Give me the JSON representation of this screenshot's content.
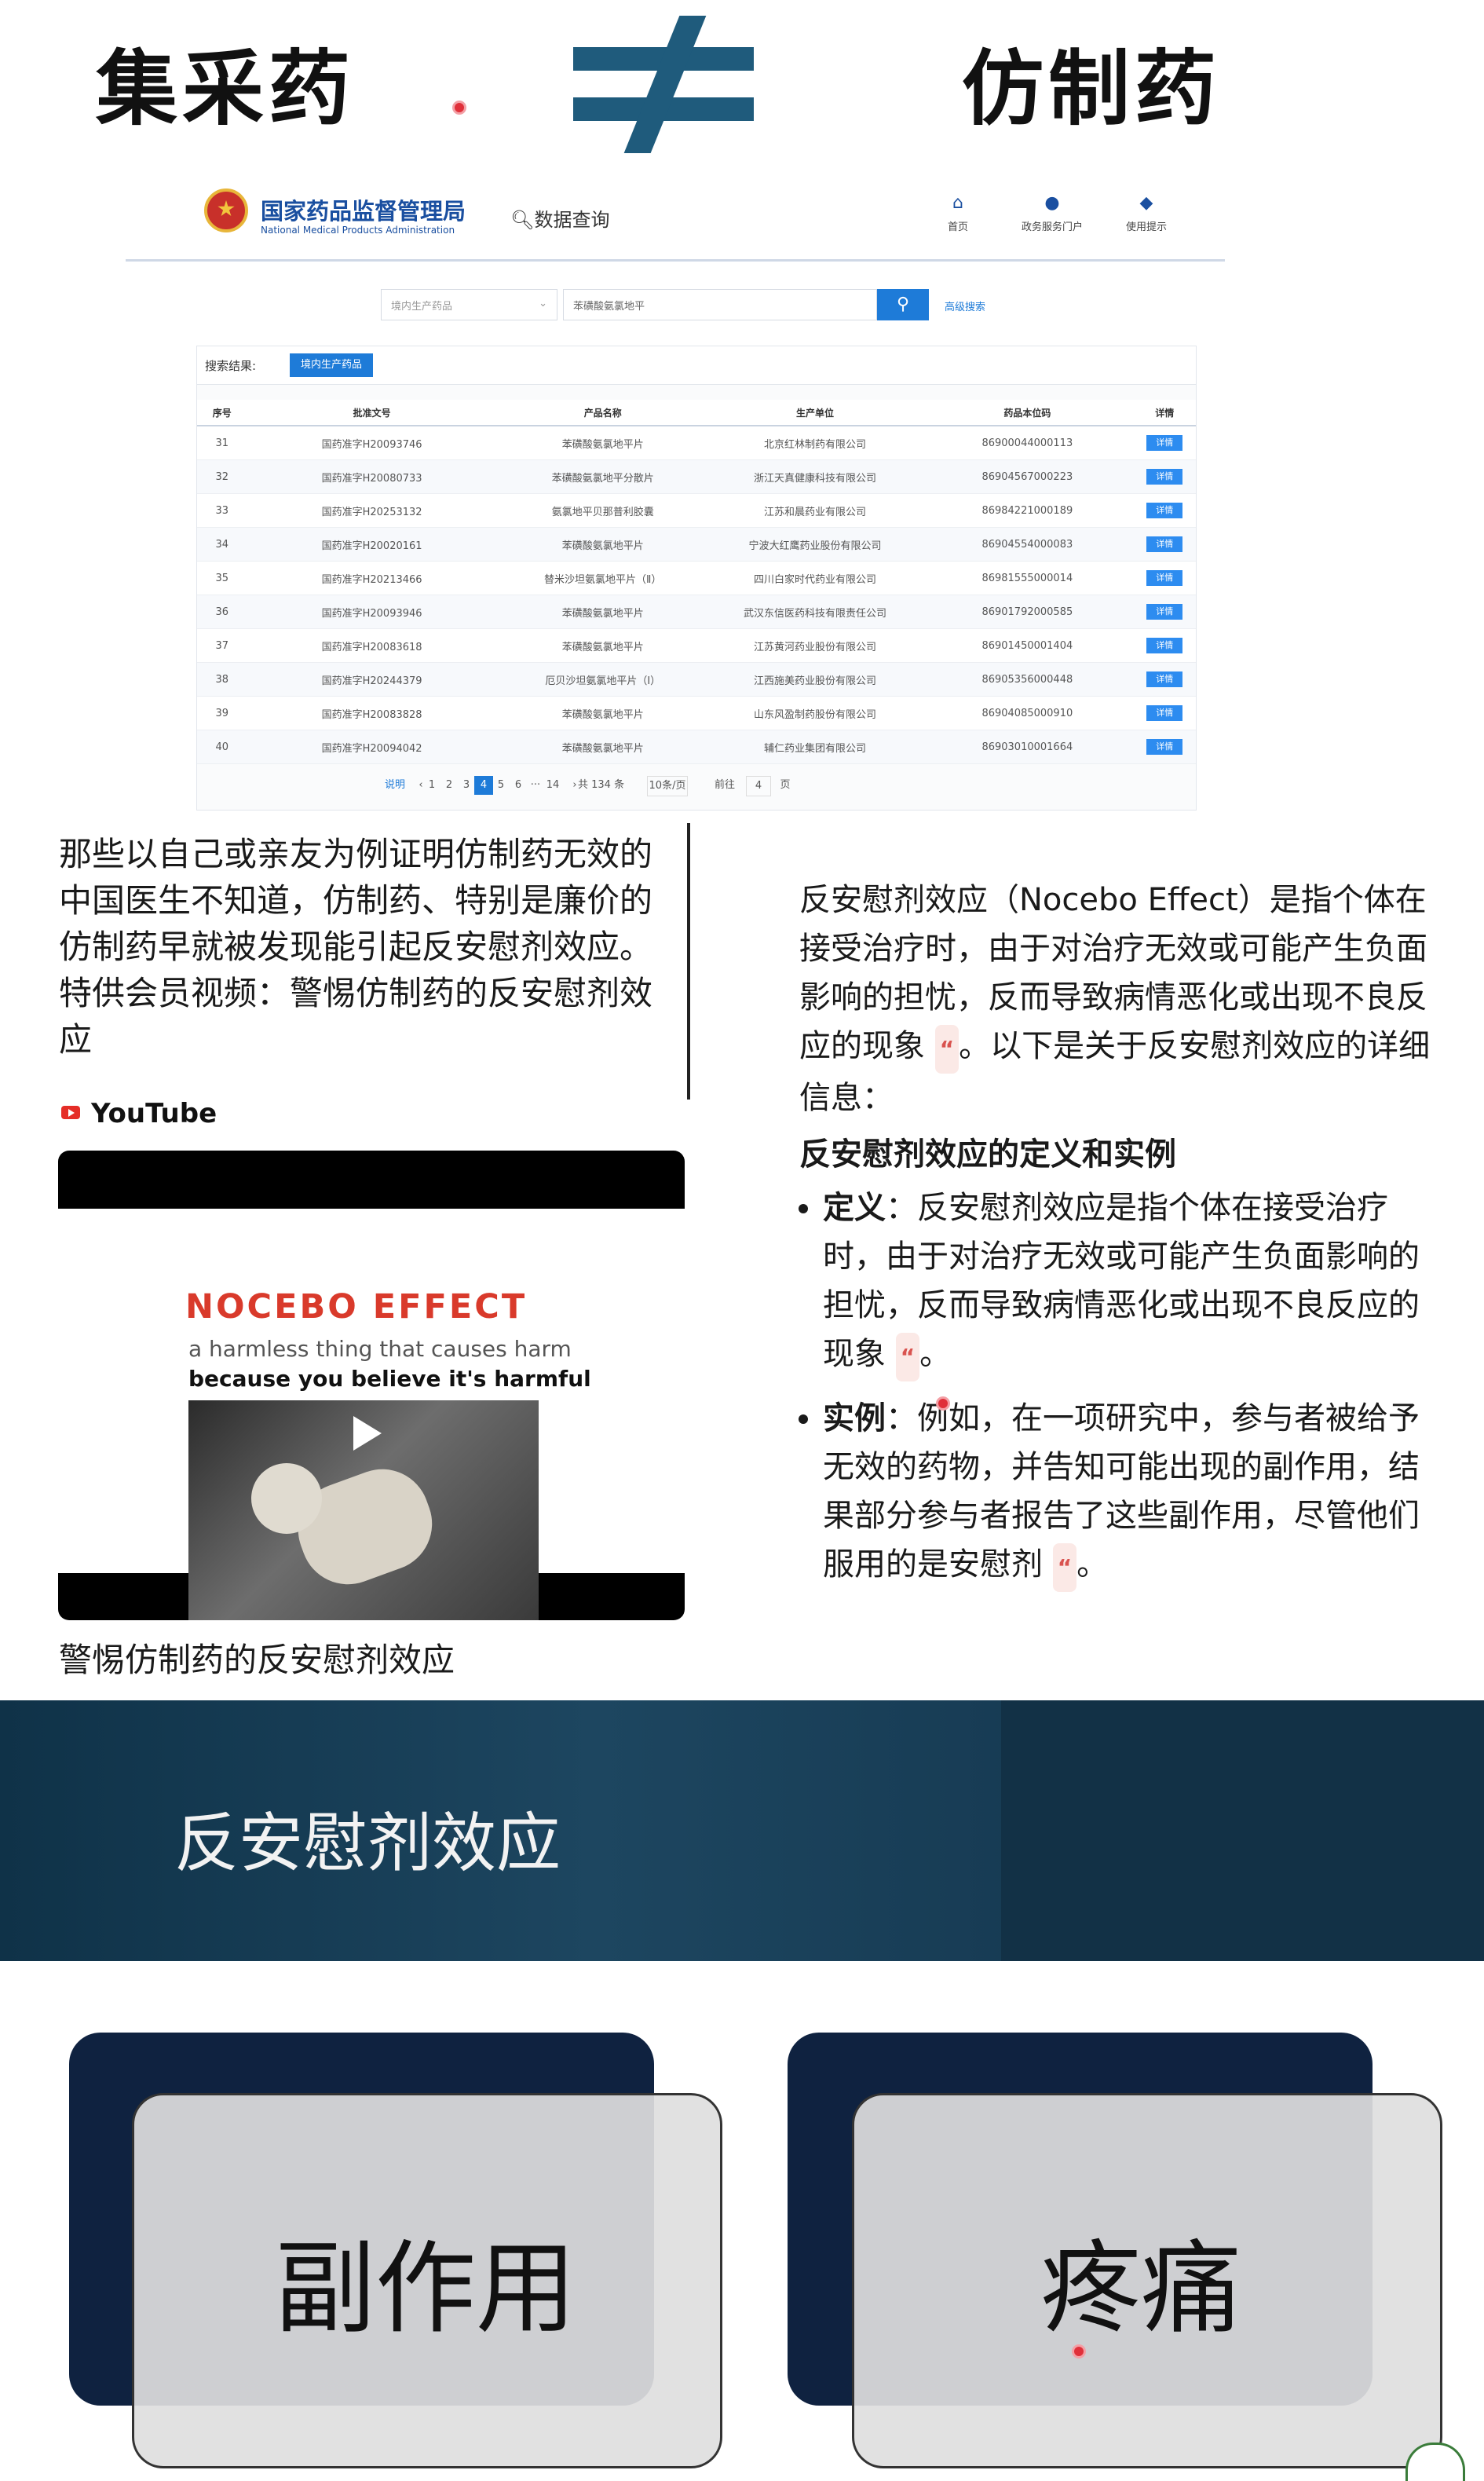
{
  "top": {
    "left_title": "集采药",
    "right_title": "仿制药"
  },
  "nmpa": {
    "agency_cn": "国家药品监督管理局",
    "agency_en": "National Medical Products Administration",
    "data_query": "数据查询",
    "nav": [
      {
        "label": "首页",
        "icon": "home-icon"
      },
      {
        "label": "政务服务门户",
        "icon": "user-icon"
      },
      {
        "label": "使用提示",
        "icon": "location-icon"
      }
    ],
    "select_value": "境内生产药品",
    "search_value": "苯磺酸氨氯地平",
    "advanced_search": "高级搜索",
    "result_label": "搜索结果:",
    "result_tag": "境内生产药品",
    "columns": [
      "序号",
      "批准文号",
      "产品名称",
      "生产单位",
      "药品本位码",
      "详情"
    ],
    "rows": [
      [
        "31",
        "国药准字H20093746",
        "苯磺酸氨氯地平片",
        "北京红林制药有限公司",
        "86900044000113",
        "详情"
      ],
      [
        "32",
        "国药准字H20080733",
        "苯磺酸氨氯地平分散片",
        "浙江天真健康科技有限公司",
        "86904567000223",
        "详情"
      ],
      [
        "33",
        "国药准字H20253132",
        "氨氯地平贝那普利胶囊",
        "江苏和晨药业有限公司",
        "86984221000189",
        "详情"
      ],
      [
        "34",
        "国药准字H20020161",
        "苯磺酸氨氯地平片",
        "宁波大红鹰药业股份有限公司",
        "86904554000083",
        "详情"
      ],
      [
        "35",
        "国药准字H20213466",
        "替米沙坦氨氯地平片（Ⅱ）",
        "四川白家时代药业有限公司",
        "86981555000014",
        "详情"
      ],
      [
        "36",
        "国药准字H20093946",
        "苯磺酸氨氯地平片",
        "武汉东信医药科技有限责任公司",
        "86901792000585",
        "详情"
      ],
      [
        "37",
        "国药准字H20083618",
        "苯磺酸氨氯地平片",
        "江苏黄河药业股份有限公司",
        "86901450001404",
        "详情"
      ],
      [
        "38",
        "国药准字H20244379",
        "厄贝沙坦氨氯地平片（Ⅰ）",
        "江西施美药业股份有限公司",
        "86905356000448",
        "详情"
      ],
      [
        "39",
        "国药准字H20083828",
        "苯磺酸氨氯地平片",
        "山东风盈制药股份有限公司",
        "86904085000910",
        "详情"
      ],
      [
        "40",
        "国药准字H20094042",
        "苯磺酸氨氯地平片",
        "辅仁药业集团有限公司",
        "86903010001664",
        "详情"
      ]
    ],
    "pager": {
      "note": "说明",
      "prev": "‹",
      "pages": [
        "1",
        "2",
        "3",
        "4",
        "5",
        "6",
        "···",
        "14"
      ],
      "current": "4",
      "next": "›",
      "total": "共 134 条",
      "per_page": "10条/页",
      "goto": "前往",
      "goto_value": "4",
      "page_unit": "页"
    }
  },
  "left_post": {
    "text": "那些以自己或亲友为例证明仿制药无效的中国医生不知道，仿制药、特别是廉价的仿制药早就被发现能引起反安慰剂效应。特供会员视频：警惕仿制药的反安慰剂效应",
    "source": "YouTube",
    "video_title_big": "NOCEBO EFFECT",
    "video_line1": "a harmless thing  that causes harm",
    "video_line2": "because you believe it's harmful",
    "caption": "警惕仿制药的反安慰剂效应"
  },
  "right_post": {
    "intro_a": "反安慰剂效应（Nocebo Effect）是指个体在接受治疗时，由于对治疗无效或可能产生负面影响的担忧，反而导致病情恶化或出现不良反应的现象",
    "intro_b": "。以下是关于反安慰剂效应的详细信息：",
    "heading": "反安慰剂效应的定义和实例",
    "def_label": "定义",
    "def_text": "：反安慰剂效应是指个体在接受治疗时，由于对治疗无效或可能产生负面影响的担忧，反而导致病情恶化或出现不良反应的现象",
    "ex_label": "实例",
    "ex_text": "：例如，在一项研究中，参与者被给予无效的药物，并告知可能出现的副作用，结果部分参与者报告了这些副作用，尽管他们服用的是安慰剂",
    "cite_mark": "“",
    "period": "。"
  },
  "banner": {
    "text": "反安慰剂效应"
  },
  "cards": [
    {
      "label": "副作用"
    },
    {
      "label": "疼痛"
    }
  ]
}
